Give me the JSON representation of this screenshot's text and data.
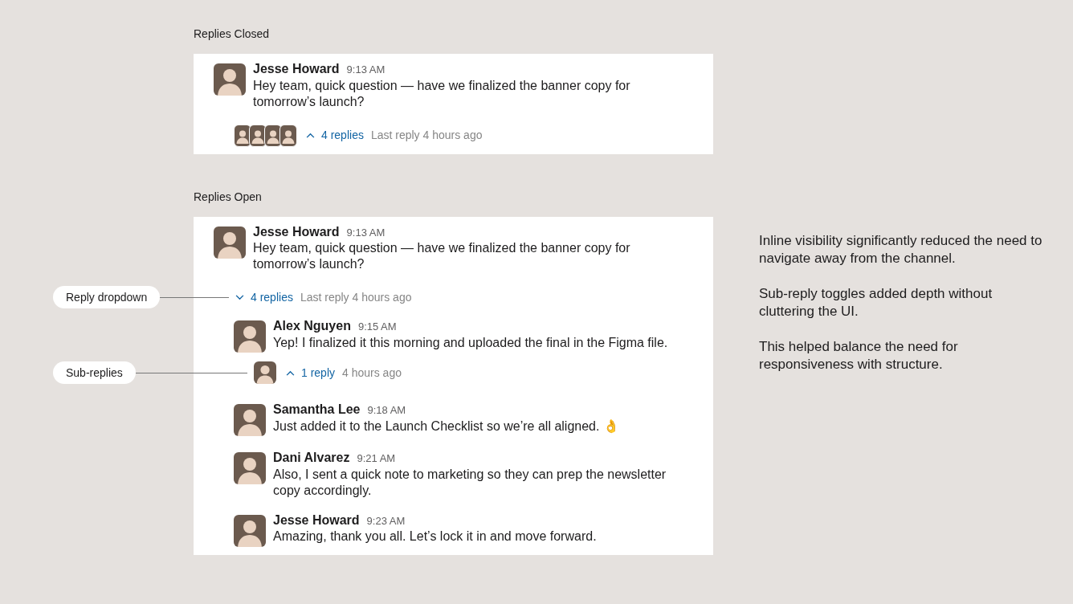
{
  "sections": [
    {
      "heading": "Replies Closed",
      "message": {
        "author": "Jesse Howard",
        "time": "9:13 AM",
        "text": "Hey team, quick question — have we finalized the banner copy for tomorrow’s launch?"
      },
      "thread": {
        "expanded": false,
        "count": "4 replies",
        "last_reply": "Last reply 4 hours ago"
      }
    },
    {
      "heading": "Replies Open",
      "message": {
        "author": "Jesse Howard",
        "time": "9:13 AM",
        "text": "Hey team, quick question — have we finalized the banner copy for tomorrow’s launch?"
      },
      "thread": {
        "expanded": true,
        "count": "4 replies",
        "last_reply": "Last reply 4 hours ago"
      },
      "replies": [
        {
          "author": "Alex Nguyen",
          "time": "9:15 AM",
          "text": "Yep! I finalized it this morning and uploaded the final in the Figma file.",
          "sub_thread": {
            "expanded": false,
            "count": "1 reply",
            "last_reply": "4 hours ago"
          }
        },
        {
          "author": "Samantha Lee",
          "time": "9:18 AM",
          "text": "Just added it to the Launch Checklist so we’re all aligned. 👌"
        },
        {
          "author": "Dani Alvarez",
          "time": "9:21 AM",
          "text": "Also, I sent a quick note to marketing so they can prep the newsletter copy accordingly."
        },
        {
          "author": "Jesse Howard",
          "time": "9:23 AM",
          "text": "Amazing, thank you all. Let’s lock it in and move forward."
        }
      ]
    }
  ],
  "callouts": [
    {
      "label": "Reply dropdown"
    },
    {
      "label": "Sub-replies"
    }
  ],
  "notes": [
    "Inline visibility significantly reduced the need to navigate away from the channel.",
    "Sub-reply toggles added depth without cluttering the UI.",
    "This helped balance the need for responsiveness with structure."
  ]
}
